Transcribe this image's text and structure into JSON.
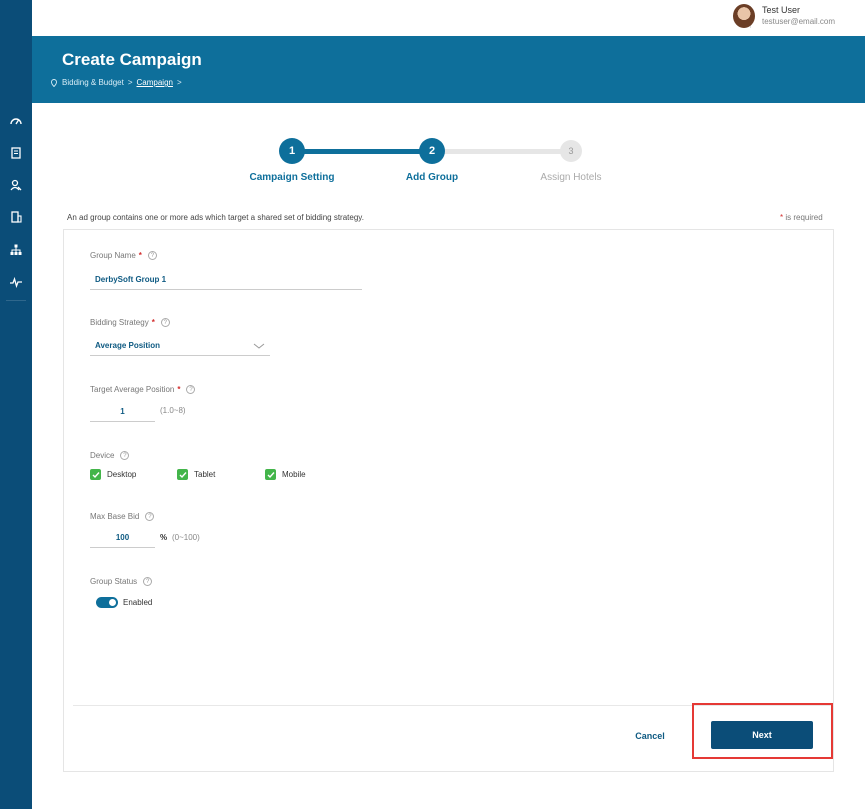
{
  "user": {
    "name": "Test User",
    "email": "testuser@email.com"
  },
  "header": {
    "title": "Create Campaign",
    "breadcrumb": [
      "Bidding & Budget",
      "Campaign"
    ],
    "separator": ">"
  },
  "sidebar": {
    "icons": [
      "dashboard-icon",
      "document-icon",
      "search-user-icon",
      "building-icon",
      "org-chart-icon",
      "activity-icon"
    ]
  },
  "stepper": {
    "steps": [
      {
        "number": "1",
        "label": "Campaign Setting",
        "state": "done"
      },
      {
        "number": "2",
        "label": "Add Group",
        "state": "active"
      },
      {
        "number": "3",
        "label": "Assign Hotels",
        "state": "pending"
      }
    ]
  },
  "form": {
    "intro": "An ad group contains one or more ads which target a shared set of bidding strategy.",
    "required_note": "is required",
    "group_name": {
      "label": "Group Name",
      "value": "DerbySoft Group 1"
    },
    "bidding_strategy": {
      "label": "Bidding Strategy",
      "value": "Average Position"
    },
    "target_avg_position": {
      "label": "Target Average Position",
      "value": "1",
      "hint": "(1.0~8)"
    },
    "device": {
      "label": "Device",
      "options": [
        {
          "label": "Desktop",
          "checked": true
        },
        {
          "label": "Tablet",
          "checked": true
        },
        {
          "label": "Mobile",
          "checked": true
        }
      ]
    },
    "max_base_bid": {
      "label": "Max Base Bid",
      "value": "100",
      "unit": "%",
      "hint": "(0~100)"
    },
    "group_status": {
      "label": "Group Status",
      "value": "Enabled",
      "enabled": true
    }
  },
  "actions": {
    "cancel": "Cancel",
    "next": "Next"
  },
  "colors": {
    "brand": "#0e6f9b",
    "sidebar": "#0b4d78",
    "check": "#43b54a",
    "required": "#d32f2f",
    "highlight": "#e53935"
  }
}
